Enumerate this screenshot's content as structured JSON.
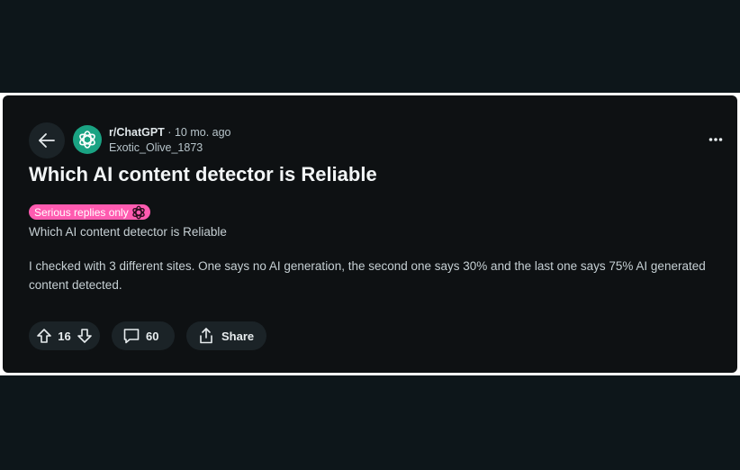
{
  "post": {
    "subreddit": "r/ChatGPT",
    "separator": "·",
    "time_ago": "10 mo. ago",
    "author": "Exotic_Olive_1873",
    "title": "Which AI content detector is Reliable",
    "flair": "Serious replies only",
    "subtitle": "Which AI content detector is Reliable",
    "body": "I checked with 3 different sites. One says no AI generation, the second one says 30% and the last one says 75% AI generated content detected."
  },
  "actions": {
    "vote_count": "16",
    "comment_count": "60",
    "share_label": "Share"
  },
  "icons": {
    "back": "arrow-left-icon",
    "avatar": "chatgpt-logo-icon",
    "more": "more-options-icon",
    "upvote": "upvote-arrow-icon",
    "downvote": "downvote-arrow-icon",
    "comment": "comment-bubble-icon",
    "share": "share-icon"
  },
  "colors": {
    "background": "#0d161a",
    "card": "#0e1113",
    "flair": "#ff5bb0",
    "avatar": "#1aa383",
    "button": "#1b2327"
  }
}
